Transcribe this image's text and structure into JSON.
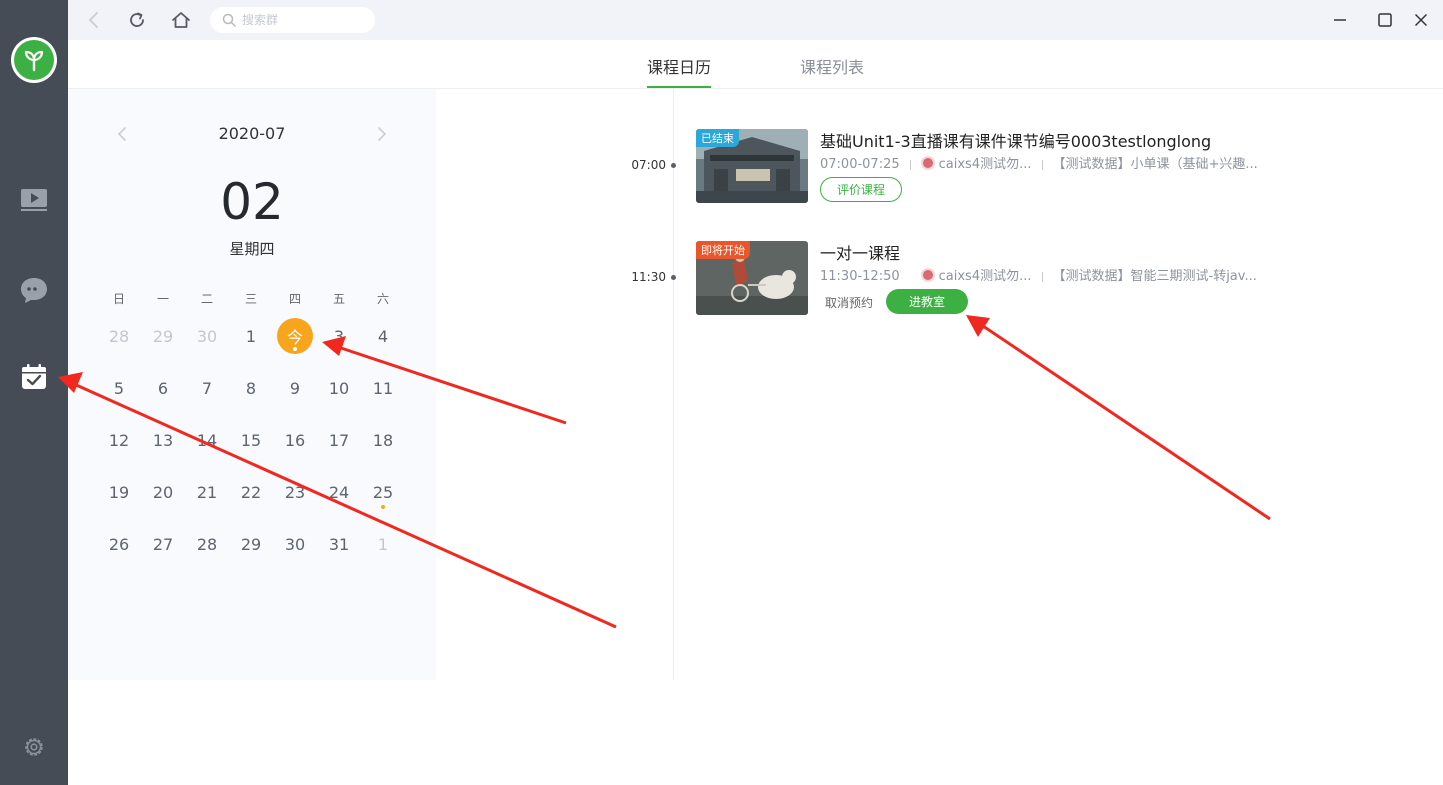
{
  "search": {
    "placeholder": "搜索群"
  },
  "tabs": [
    {
      "label": "课程日历",
      "active": true
    },
    {
      "label": "课程列表",
      "active": false
    }
  ],
  "calendar": {
    "month": "2020-07",
    "selected_day": "02",
    "selected_weekday": "星期四",
    "weekday_headers": [
      "日",
      "一",
      "二",
      "三",
      "四",
      "五",
      "六"
    ],
    "today_label": "今",
    "weeks": [
      [
        "28",
        "29",
        "30",
        "1",
        "今",
        "3",
        "4"
      ],
      [
        "5",
        "6",
        "7",
        "8",
        "9",
        "10",
        "11"
      ],
      [
        "12",
        "13",
        "14",
        "15",
        "16",
        "17",
        "18"
      ],
      [
        "19",
        "20",
        "21",
        "22",
        "23",
        "24",
        "25"
      ],
      [
        "26",
        "27",
        "28",
        "29",
        "30",
        "31",
        "1"
      ]
    ]
  },
  "courses": [
    {
      "time": "07:00",
      "badge": "已结束",
      "title": "基础Unit1-3直播课有课件课节编号0003testlonglong",
      "time_range": "07:00-07:25",
      "teacher": "caixs4测试勿...",
      "category": "【测试数据】小单课（基础+兴趣...",
      "action": "评价课程"
    },
    {
      "time": "11:30",
      "badge": "即将开始",
      "title": "一对一课程",
      "time_range": "11:30-12:50",
      "teacher": "caixs4测试勿...",
      "category": "【测试数据】智能三期测试-转jav...",
      "cancel": "取消预约",
      "enter": "进教室"
    }
  ],
  "colors": {
    "accent_green": "#3db044",
    "today_orange": "#f7a51c",
    "badge_ended": "#2ba7d8",
    "badge_upcoming": "#e9562b",
    "arrow_red": "#f0281e",
    "sidebar": "#464c56"
  }
}
